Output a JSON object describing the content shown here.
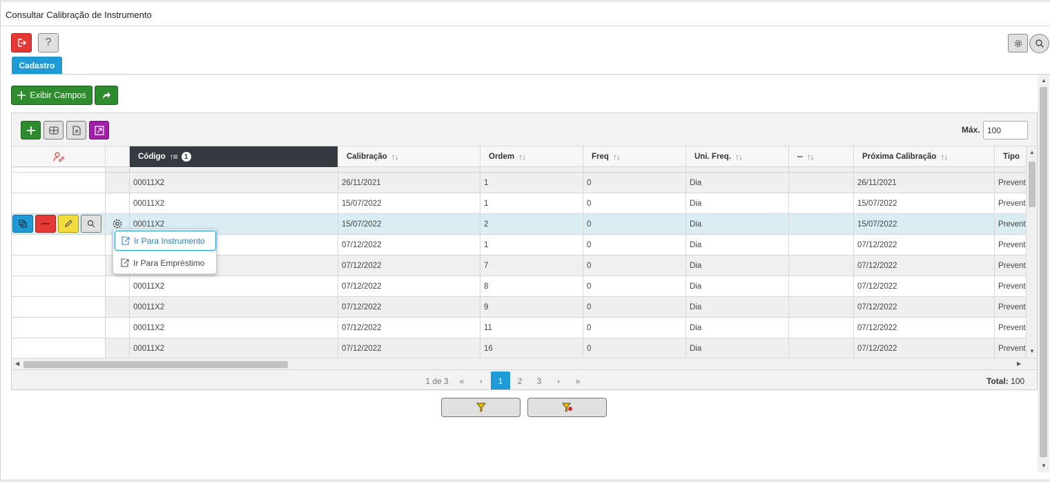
{
  "window": {
    "title": "Consultar Calibração de Instrumento"
  },
  "top_toolbar": {
    "exit_icon": "exit-icon",
    "help_label": "?",
    "gear_icon": "gear-icon",
    "search_icon": "search-icon"
  },
  "tabs": [
    {
      "label": "Cadastro",
      "active": true
    }
  ],
  "actions": {
    "exibir_label": "Exibir Campos",
    "share_icon": "share-arrow-icon"
  },
  "grid_toolbar": {
    "max_label": "Máx.",
    "max_value": "100"
  },
  "columns": [
    {
      "label": "",
      "icon": "user-edit-icon"
    },
    {
      "label": ""
    },
    {
      "label": "Código",
      "sort_badge": "1",
      "active": true
    },
    {
      "label": "Calibração"
    },
    {
      "label": "Ordem"
    },
    {
      "label": "Freq"
    },
    {
      "label": "Uni. Freq."
    },
    {
      "label": "--"
    },
    {
      "label": "Próxima Calibração"
    },
    {
      "label": "Tipo"
    }
  ],
  "rows": [
    {
      "codigo": "00011X2",
      "calibracao": "26/11/2021",
      "ordem": "1",
      "freq": "0",
      "uni": "Dia",
      "dash": "",
      "proxima": "26/11/2021",
      "tipo": "Preventi"
    },
    {
      "codigo": "00011X2",
      "calibracao": "15/07/2022",
      "ordem": "1",
      "freq": "0",
      "uni": "Dia",
      "dash": "",
      "proxima": "15/07/2022",
      "tipo": "Preventi"
    },
    {
      "codigo": "00011X2",
      "calibracao": "15/07/2022",
      "ordem": "2",
      "freq": "0",
      "uni": "Dia",
      "dash": "",
      "proxima": "15/07/2022",
      "tipo": "Preventi"
    },
    {
      "codigo": "",
      "calibracao": "07/12/2022",
      "ordem": "1",
      "freq": "0",
      "uni": "Dia",
      "dash": "",
      "proxima": "07/12/2022",
      "tipo": "Preventi"
    },
    {
      "codigo": "",
      "calibracao": "07/12/2022",
      "ordem": "7",
      "freq": "0",
      "uni": "Dia",
      "dash": "",
      "proxima": "07/12/2022",
      "tipo": "Preventi"
    },
    {
      "codigo": "00011X2",
      "calibracao": "07/12/2022",
      "ordem": "8",
      "freq": "0",
      "uni": "Dia",
      "dash": "",
      "proxima": "07/12/2022",
      "tipo": "Preventi"
    },
    {
      "codigo": "00011X2",
      "calibracao": "07/12/2022",
      "ordem": "9",
      "freq": "0",
      "uni": "Dia",
      "dash": "",
      "proxima": "07/12/2022",
      "tipo": "Preventi"
    },
    {
      "codigo": "00011X2",
      "calibracao": "07/12/2022",
      "ordem": "11",
      "freq": "0",
      "uni": "Dia",
      "dash": "",
      "proxima": "07/12/2022",
      "tipo": "Preventi"
    },
    {
      "codigo": "00011X2",
      "calibracao": "07/12/2022",
      "ordem": "16",
      "freq": "0",
      "uni": "Dia",
      "dash": "",
      "proxima": "07/12/2022",
      "tipo": "Preventi"
    }
  ],
  "row_actions": [
    "copy-icon",
    "delete-icon",
    "edit-icon",
    "view-icon"
  ],
  "context_menu": {
    "items": [
      {
        "label": "Ir Para Instrumento",
        "icon": "go-to-icon",
        "selected": true
      },
      {
        "label": "Ir Para Empréstimo",
        "icon": "go-to-icon",
        "selected": false
      }
    ]
  },
  "pager": {
    "info": "1 de 3",
    "first": "«",
    "prev": "‹",
    "pages": [
      "1",
      "2",
      "3"
    ],
    "current": "1",
    "next": "›",
    "last": "»",
    "total_label": "Total:",
    "total_value": "100"
  },
  "bottom_buttons": [
    "filter-icon",
    "clear-filter-icon"
  ],
  "colors": {
    "primary": "#1e9bd7",
    "success": "#2e8b2e",
    "danger": "#e53935",
    "warning": "#f2dd3c",
    "purple": "#a020a8",
    "header_active": "#343a40",
    "row_highlight": "#d9edf3"
  }
}
